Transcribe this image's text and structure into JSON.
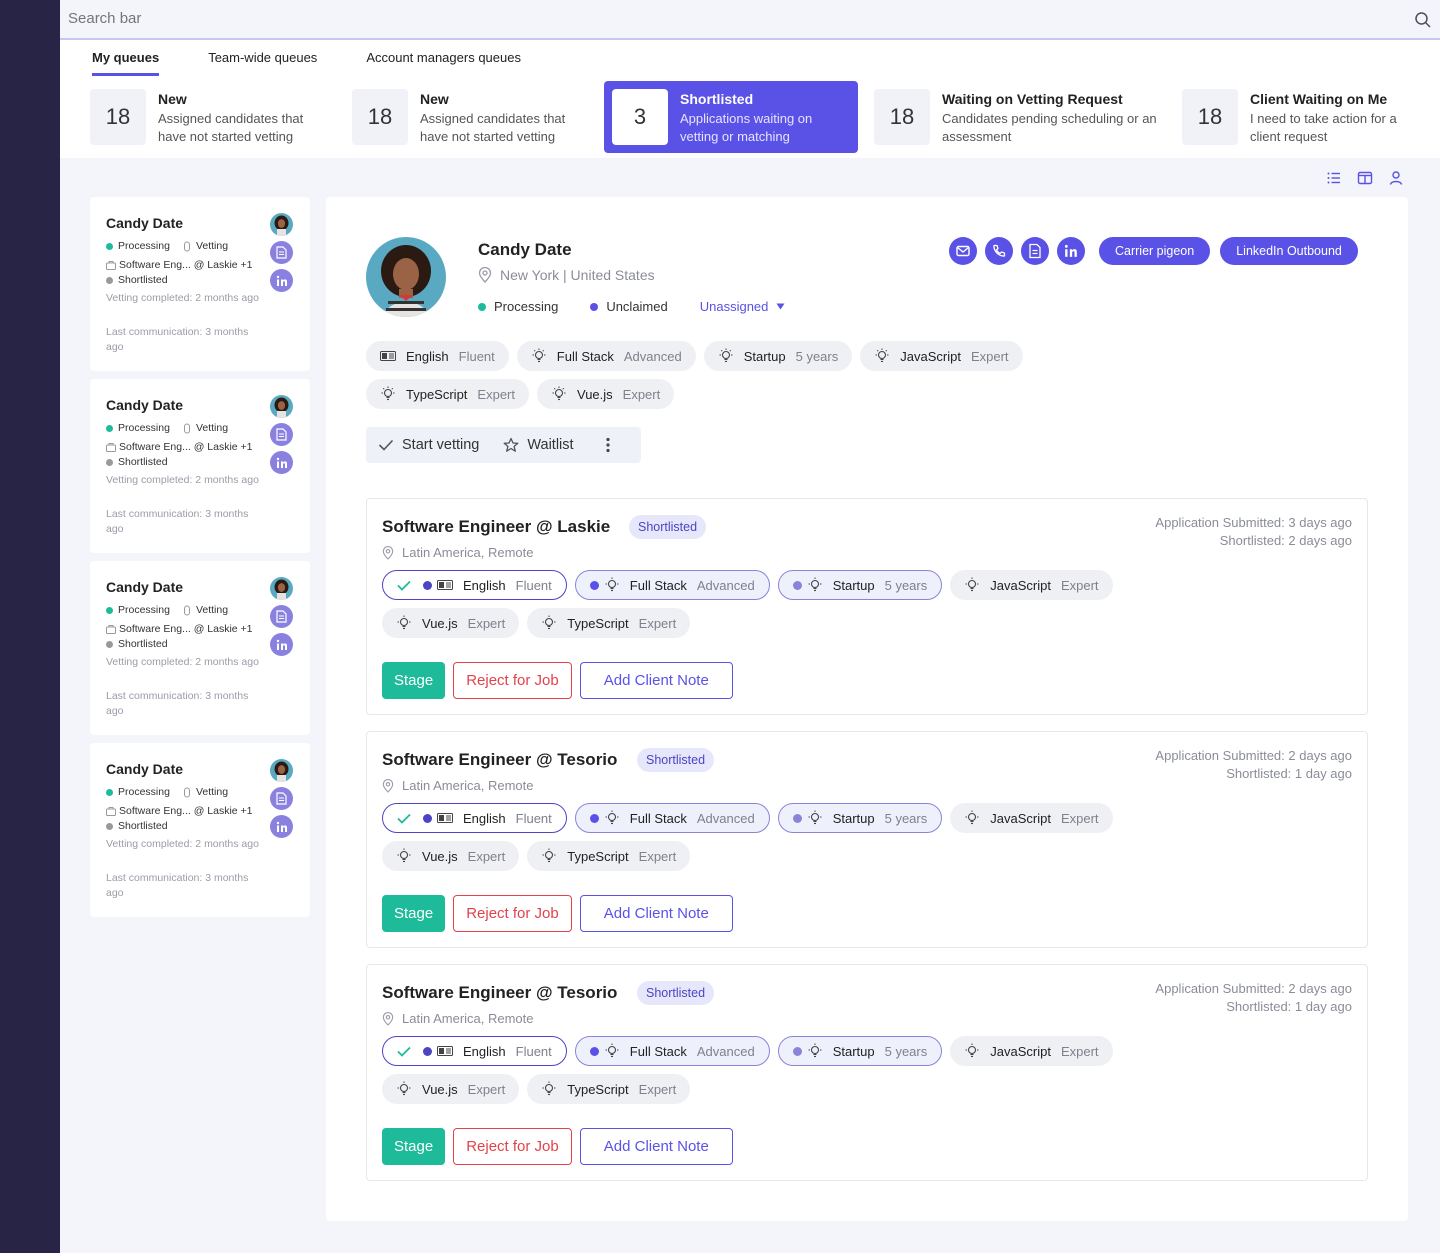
{
  "search": {
    "placeholder": "Search bar"
  },
  "tabs": [
    {
      "label": "My queues"
    },
    {
      "label": "Team-wide queues"
    },
    {
      "label": "Account managers queues"
    }
  ],
  "queues": [
    {
      "count": "18",
      "title": "New",
      "desc": "Assigned candidates that have not started vetting"
    },
    {
      "count": "18",
      "title": "New",
      "desc": "Assigned candidates that have not started vetting"
    },
    {
      "count": "3",
      "title": "Shortlisted",
      "desc": "Applications waiting on vetting or matching"
    },
    {
      "count": "18",
      "title": "Waiting on Vetting Request",
      "desc": "Candidates pending scheduling or an assessment"
    },
    {
      "count": "18",
      "title": "Client Waiting on Me",
      "desc": "I need to take action for a client request"
    }
  ],
  "candidates": [
    {
      "name": "Candy Date",
      "status": "Processing",
      "stage": "Vetting",
      "job": "Software Eng... @ Laskie +1",
      "list": "Shortlisted",
      "vetting": "Vetting completed: 2 months ago",
      "comm": "Last communication: 3 months ago"
    },
    {
      "name": "Candy Date",
      "status": "Processing",
      "stage": "Vetting",
      "job": "Software Eng... @ Laskie +1",
      "list": "Shortlisted",
      "vetting": "Vetting completed: 2 months ago",
      "comm": "Last communication: 3 months ago"
    },
    {
      "name": "Candy Date",
      "status": "Processing",
      "stage": "Vetting",
      "job": "Software Eng... @ Laskie +1",
      "list": "Shortlisted",
      "vetting": "Vetting completed: 2 months ago",
      "comm": "Last communication: 3 months ago"
    },
    {
      "name": "Candy Date",
      "status": "Processing",
      "stage": "Vetting",
      "job": "Software Eng... @ Laskie +1",
      "list": "Shortlisted",
      "vetting": "Vetting completed: 2 months ago",
      "comm": "Last communication: 3 months ago"
    }
  ],
  "profile": {
    "name": "Candy Date",
    "location": "New York | United States",
    "status": "Processing",
    "claim": "Unclaimed",
    "assignee": "Unassigned",
    "carrier_label": "Carrier pigeon",
    "linkedin_label": "LinkedIn Outbound",
    "skills": [
      {
        "name": "English",
        "level": "Fluent"
      },
      {
        "name": "Full Stack",
        "level": "Advanced"
      },
      {
        "name": "Startup",
        "level": "5 years"
      },
      {
        "name": "JavaScript",
        "level": "Expert"
      },
      {
        "name": "TypeScript",
        "level": "Expert"
      },
      {
        "name": "Vue.js",
        "level": "Expert"
      }
    ],
    "start_vetting": "Start vetting",
    "waitlist": "Waitlist"
  },
  "jobs": [
    {
      "title": "Software Engineer @ Laskie",
      "badge": "Shortlisted",
      "location": "Latin America, Remote",
      "submitted": "Application Submitted: 3 days ago",
      "shortlisted": "Shortlisted: 2 days ago"
    },
    {
      "title": "Software Engineer @ Tesorio",
      "badge": "Shortlisted",
      "location": "Latin America, Remote",
      "submitted": "Application Submitted: 2 days ago",
      "shortlisted": "Shortlisted: 1 day ago"
    },
    {
      "title": "Software Engineer @ Tesorio",
      "badge": "Shortlisted",
      "location": "Latin America, Remote",
      "submitted": "Application Submitted: 2 days ago",
      "shortlisted": "Shortlisted: 1 day ago"
    }
  ],
  "job_skills": [
    {
      "name": "English",
      "level": "Fluent"
    },
    {
      "name": "Full Stack",
      "level": "Advanced"
    },
    {
      "name": "Startup",
      "level": "5 years"
    },
    {
      "name": "JavaScript",
      "level": "Expert"
    },
    {
      "name": "Vue.js",
      "level": "Expert"
    },
    {
      "name": "TypeScript",
      "level": "Expert"
    }
  ],
  "actions": {
    "stage": "Stage",
    "reject": "Reject for Job",
    "note": "Add Client Note"
  },
  "colors": {
    "accent": "#5a52e6",
    "green": "#1dbb9a",
    "red": "#e2434b",
    "sidebar": "#282446"
  }
}
